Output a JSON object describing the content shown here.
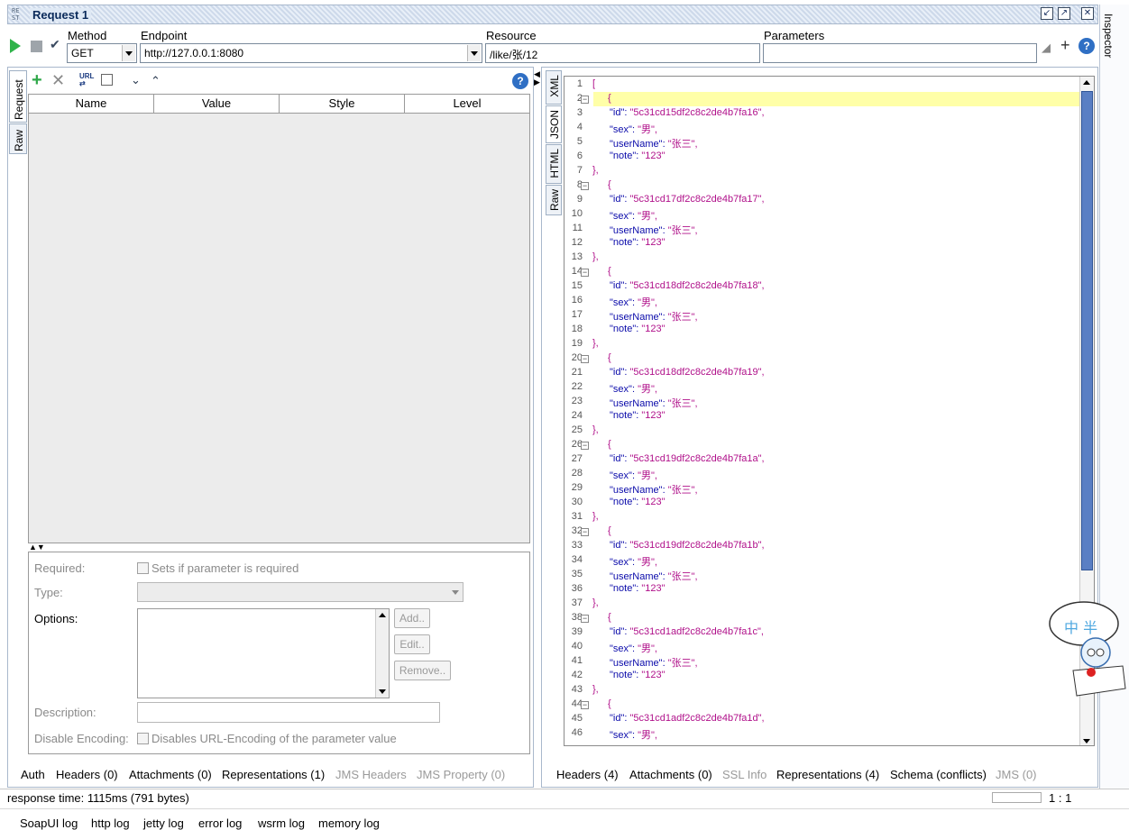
{
  "title": {
    "rest_badge": "RE ST",
    "text": "Request 1"
  },
  "toolbar": {
    "method_label": "Method",
    "method_value": "GET",
    "endpoint_label": "Endpoint",
    "endpoint_value": "http://127.0.0.1:8080",
    "resource_label": "Resource",
    "resource_value": "/like/张/12",
    "parameters_label": "Parameters",
    "parameters_value": ""
  },
  "inspector_label": "Inspector",
  "left": {
    "vertical_tabs": [
      "Request",
      "Raw"
    ],
    "grid_columns": [
      "Name",
      "Value",
      "Style",
      "Level"
    ],
    "props": {
      "required_label": "Required:",
      "required_text": "Sets if parameter is required",
      "type_label": "Type:",
      "options_label": "Options:",
      "add_btn": "Add..",
      "edit_btn": "Edit..",
      "remove_btn": "Remove..",
      "description_label": "Description:",
      "disable_encoding_label": "Disable Encoding:",
      "disable_encoding_text": "Disables URL-Encoding of the parameter value"
    },
    "bottom_tabs": [
      "Auth",
      "Headers (0)",
      "Attachments (0)",
      "Representations (1)",
      "JMS Headers",
      "JMS Property (0)"
    ]
  },
  "right": {
    "vertical_tabs": [
      "XML",
      "JSON",
      "HTML",
      "Raw"
    ],
    "lines": [
      {
        "n": "1",
        "t": "["
      },
      {
        "n": "2",
        "t": "{",
        "fold": true
      },
      {
        "n": "3",
        "k": "\"id\"",
        "v": "\"5c31cd15df2c8c2de4b7fa16\","
      },
      {
        "n": "4",
        "k": "\"sex\"",
        "v": "\"男\","
      },
      {
        "n": "5",
        "k": "\"userName\"",
        "v": "\"张三\","
      },
      {
        "n": "6",
        "k": "\"note\"",
        "v": "\"123\""
      },
      {
        "n": "7",
        "t": "},"
      },
      {
        "n": "8",
        "t": "{",
        "fold": true
      },
      {
        "n": "9",
        "k": "\"id\"",
        "v": "\"5c31cd17df2c8c2de4b7fa17\","
      },
      {
        "n": "10",
        "k": "\"sex\"",
        "v": "\"男\","
      },
      {
        "n": "11",
        "k": "\"userName\"",
        "v": "\"张三\","
      },
      {
        "n": "12",
        "k": "\"note\"",
        "v": "\"123\""
      },
      {
        "n": "13",
        "t": "},"
      },
      {
        "n": "14",
        "t": "{",
        "fold": true
      },
      {
        "n": "15",
        "k": "\"id\"",
        "v": "\"5c31cd18df2c8c2de4b7fa18\","
      },
      {
        "n": "16",
        "k": "\"sex\"",
        "v": "\"男\","
      },
      {
        "n": "17",
        "k": "\"userName\"",
        "v": "\"张三\","
      },
      {
        "n": "18",
        "k": "\"note\"",
        "v": "\"123\""
      },
      {
        "n": "19",
        "t": "},"
      },
      {
        "n": "20",
        "t": "{",
        "fold": true
      },
      {
        "n": "21",
        "k": "\"id\"",
        "v": "\"5c31cd18df2c8c2de4b7fa19\","
      },
      {
        "n": "22",
        "k": "\"sex\"",
        "v": "\"男\","
      },
      {
        "n": "23",
        "k": "\"userName\"",
        "v": "\"张三\","
      },
      {
        "n": "24",
        "k": "\"note\"",
        "v": "\"123\""
      },
      {
        "n": "25",
        "t": "},"
      },
      {
        "n": "26",
        "t": "{",
        "fold": true
      },
      {
        "n": "27",
        "k": "\"id\"",
        "v": "\"5c31cd19df2c8c2de4b7fa1a\","
      },
      {
        "n": "28",
        "k": "\"sex\"",
        "v": "\"男\","
      },
      {
        "n": "29",
        "k": "\"userName\"",
        "v": "\"张三\","
      },
      {
        "n": "30",
        "k": "\"note\"",
        "v": "\"123\""
      },
      {
        "n": "31",
        "t": "},"
      },
      {
        "n": "32",
        "t": "{",
        "fold": true
      },
      {
        "n": "33",
        "k": "\"id\"",
        "v": "\"5c31cd19df2c8c2de4b7fa1b\","
      },
      {
        "n": "34",
        "k": "\"sex\"",
        "v": "\"男\","
      },
      {
        "n": "35",
        "k": "\"userName\"",
        "v": "\"张三\","
      },
      {
        "n": "36",
        "k": "\"note\"",
        "v": "\"123\""
      },
      {
        "n": "37",
        "t": "},"
      },
      {
        "n": "38",
        "t": "{",
        "fold": true
      },
      {
        "n": "39",
        "k": "\"id\"",
        "v": "\"5c31cd1adf2c8c2de4b7fa1c\","
      },
      {
        "n": "40",
        "k": "\"sex\"",
        "v": "\"男\","
      },
      {
        "n": "41",
        "k": "\"userName\"",
        "v": "\"张三\","
      },
      {
        "n": "42",
        "k": "\"note\"",
        "v": "\"123\""
      },
      {
        "n": "43",
        "t": "},"
      },
      {
        "n": "44",
        "t": "{",
        "fold": true
      },
      {
        "n": "45",
        "k": "\"id\"",
        "v": "\"5c31cd1adf2c8c2de4b7fa1d\","
      },
      {
        "n": "46",
        "k": "\"sex\"",
        "v": "\"男\","
      }
    ],
    "bottom_tabs": [
      "Headers (4)",
      "Attachments (0)",
      "SSL Info",
      "Representations (4)",
      "Schema (conflicts)",
      "JMS (0)"
    ]
  },
  "status": {
    "response_time": "response time: 1115ms (791 bytes)",
    "position": "1 : 1"
  },
  "logs": [
    "SoapUI log",
    "http log",
    "jetty log",
    "error log",
    "wsrm log",
    "memory log"
  ],
  "stamp_text": "中 半",
  "colors": {
    "json_key": "#0a0aaa",
    "json_value": "#b0108a",
    "highlight": "#ffffa8",
    "scroll_thumb": "#5a7fc4"
  }
}
